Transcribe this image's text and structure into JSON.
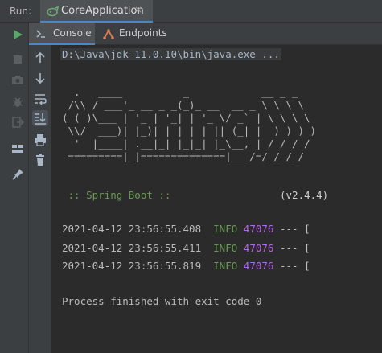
{
  "run_bar": {
    "label": "Run:",
    "tab_title": "CoreApplication",
    "close_glyph": "×"
  },
  "subtabs": [
    {
      "label": "Console",
      "icon": "console-icon"
    },
    {
      "label": "Endpoints",
      "icon": "endpoints-icon"
    }
  ],
  "console": {
    "command": "D:\\Java\\jdk-11.0.10\\bin\\java.exe ...",
    "banner": [
      "  .   ____          _            __ _ _",
      " /\\\\ / ___'_ __ _ _(_)_ __  __ _ \\ \\ \\ \\",
      "( ( )\\___ | '_ | '_| | '_ \\/ _` | \\ \\ \\ \\",
      " \\\\/  ___)| |_)| | | | | || (_| |  ) ) ) )",
      "  '  |____| .__|_| |_|_| |_\\__, | / / / /",
      " =========|_|==============|___/=/_/_/_/"
    ],
    "spring_label": " :: Spring Boot :: ",
    "spring_version": "(v2.4.4)",
    "logs": [
      {
        "timestamp": "2021-04-12 23:56:55.408",
        "level": "INFO",
        "pid": "47076",
        "rest": "--- ["
      },
      {
        "timestamp": "2021-04-12 23:56:55.411",
        "level": "INFO",
        "pid": "47076",
        "rest": "--- ["
      },
      {
        "timestamp": "2021-04-12 23:56:55.819",
        "level": "INFO",
        "pid": "47076",
        "rest": "--- ["
      }
    ],
    "exit_message": "Process finished with exit code 0"
  },
  "colors": {
    "accent": "#4a88c7",
    "run_green": "#59a869",
    "info_green": "#6a9955",
    "pid_purple": "#b267e6"
  },
  "icons": {
    "left_column": [
      "rerun-icon",
      "stop-icon",
      "camera-icon",
      "debug-icon",
      "exit-icon",
      "layout-icon",
      "pin-icon"
    ],
    "second_column": [
      "scroll-up-icon",
      "scroll-down-icon",
      "soft-wrap-icon",
      "scroll-to-end-icon",
      "print-icon",
      "trash-icon"
    ]
  }
}
